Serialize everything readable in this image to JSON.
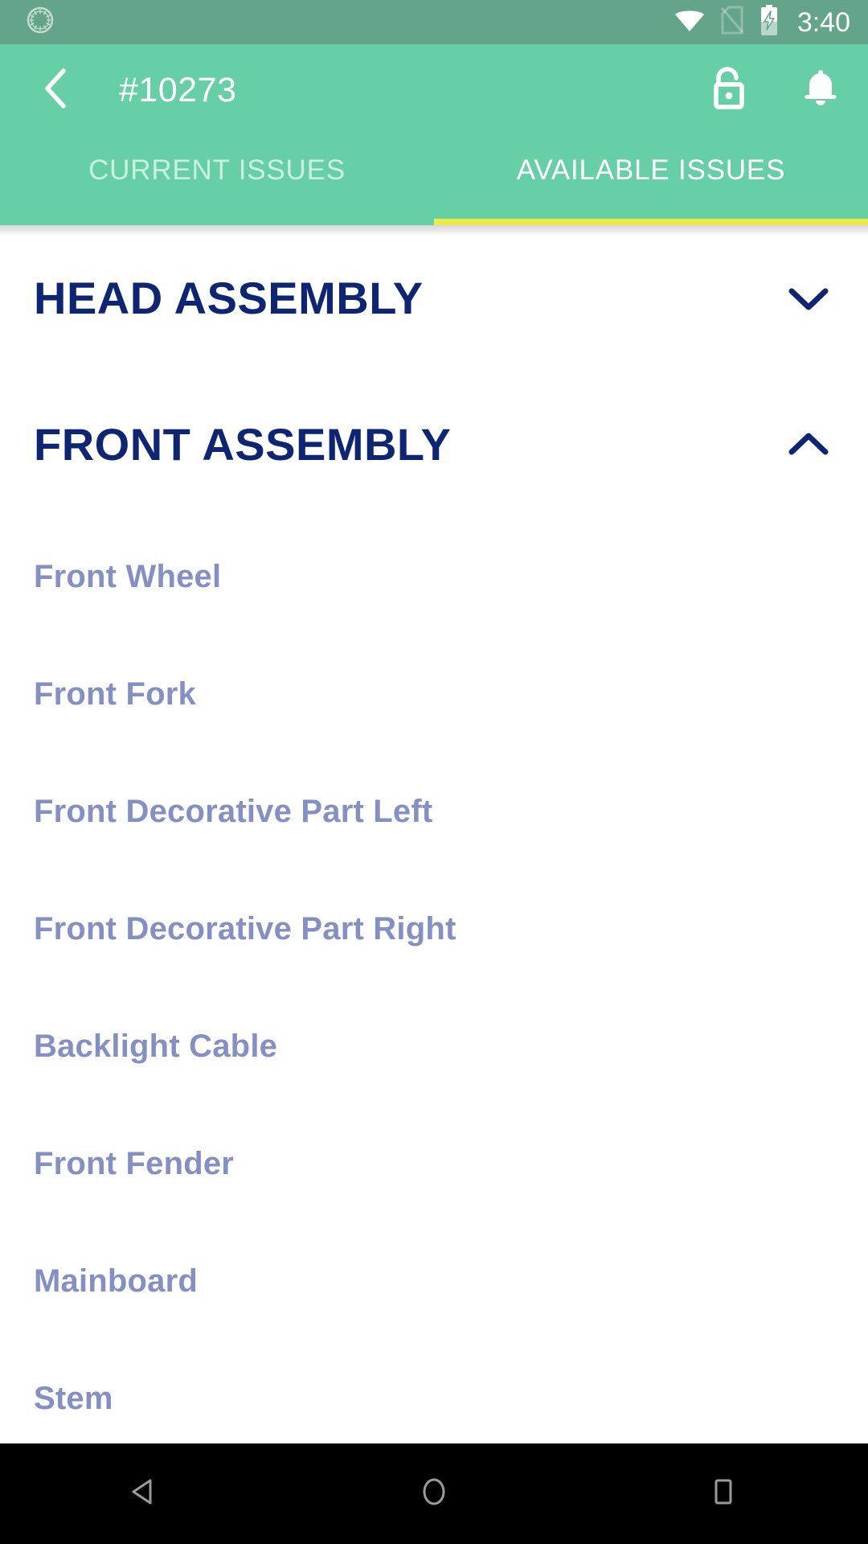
{
  "status_bar": {
    "notification_icon": "sync-circle-icon",
    "wifi_icon": "wifi-icon",
    "sim_icon": "sim-card-off-icon",
    "battery_icon": "battery-charging-icon",
    "time": "3:40",
    "background_color": "#64A488"
  },
  "app_bar": {
    "back_icon": "back-chevron-icon",
    "title": "#10273",
    "lock_icon": "unlock-icon",
    "bell_icon": "notification-bell-icon",
    "background_color": "#66CFA6"
  },
  "tabs": {
    "indicator_color": "#ECE94A",
    "items": [
      {
        "label": "CURRENT ISSUES",
        "active": false
      },
      {
        "label": "AVAILABLE ISSUES",
        "active": true
      }
    ]
  },
  "sections": [
    {
      "title": "HEAD ASSEMBLY",
      "expanded": false,
      "chevron_icon": "chevron-down-icon",
      "items": []
    },
    {
      "title": "FRONT ASSEMBLY",
      "expanded": true,
      "chevron_icon": "chevron-up-icon",
      "items": [
        {
          "label": "Front Wheel"
        },
        {
          "label": "Front Fork"
        },
        {
          "label": "Front Decorative Part Left"
        },
        {
          "label": "Front Decorative Part Right"
        },
        {
          "label": "Backlight Cable"
        },
        {
          "label": "Front Fender"
        },
        {
          "label": "Mainboard"
        },
        {
          "label": "Stem"
        }
      ]
    }
  ],
  "colors": {
    "section_title": "#0D2573",
    "item_label": "#8490C4",
    "accent_green": "#66CFA6",
    "accent_yellow": "#ECE94A"
  },
  "nav_bar": {
    "back": "nav-back-icon",
    "home": "nav-home-icon",
    "recents": "nav-recents-icon"
  }
}
